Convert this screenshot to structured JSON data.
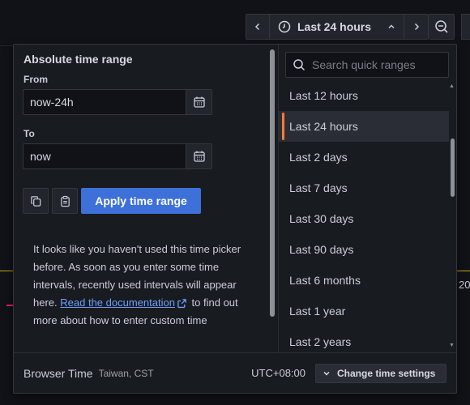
{
  "toolbar": {
    "prev_icon": "chevron-left-icon",
    "range_icon": "clock-icon",
    "range_label": "Last 24 hours",
    "range_chevron": "chevron-up-icon",
    "next_icon": "chevron-right-icon",
    "zoom_icon": "zoom-out-icon"
  },
  "background": {
    "axis_label": "20"
  },
  "picker": {
    "title": "Absolute time range",
    "from_label": "From",
    "from_value": "now-24h",
    "to_label": "To",
    "to_value": "now",
    "copy_icon": "copy-icon",
    "paste_icon": "clipboard-icon",
    "apply_label": "Apply time range",
    "help_text_1": "It looks like you haven't used this time picker before. As soon as you enter some time intervals, recently used intervals will appear here.",
    "doc_link": "Read the documentation",
    "help_text_2": "to find out more about how to enter custom time"
  },
  "quick_ranges": {
    "search_placeholder": "Search quick ranges",
    "selected_index": 1,
    "items": [
      "Last 12 hours",
      "Last 24 hours",
      "Last 2 days",
      "Last 7 days",
      "Last 30 days",
      "Last 90 days",
      "Last 6 months",
      "Last 1 year",
      "Last 2 years"
    ]
  },
  "footer": {
    "tz_label": "Browser Time",
    "tz_name": "Taiwan, CST",
    "utc_offset": "UTC+08:00",
    "change_label": "Change time settings"
  },
  "colors": {
    "accent_selected": "#ff7b34",
    "apply_button": "#3d71d9",
    "link": "#6e9fff"
  }
}
